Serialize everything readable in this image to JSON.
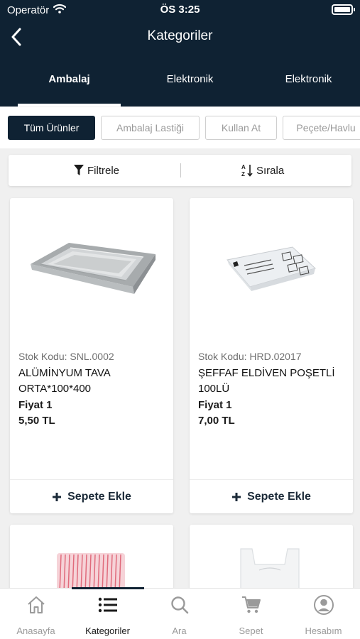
{
  "status_bar": {
    "carrier": "Operatör",
    "time": "ÖS 3:25"
  },
  "nav": {
    "title": "Kategoriler",
    "back_icon": "chevron-left-icon"
  },
  "category_tabs": [
    {
      "label": "Ambalaj",
      "active": true
    },
    {
      "label": "Elektronik",
      "active": false
    },
    {
      "label": "Elektronik",
      "active": false
    }
  ],
  "chips": [
    {
      "label": "Tüm Ürünler",
      "active": true
    },
    {
      "label": "Ambalaj Lastiği",
      "active": false
    },
    {
      "label": "Kullan At",
      "active": false
    },
    {
      "label": "Peçete/Havlu",
      "active": false
    }
  ],
  "filter_bar": {
    "filter_label": "Filtrele",
    "sort_label": "Sırala"
  },
  "products": [
    {
      "code": "Stok Kodu: SNL.0002",
      "name": "ALÜMİNYUM TAVA ORTA*100*400",
      "price_label": "Fiyat 1",
      "price": "5,50 TL",
      "add_label": "Sepete Ekle",
      "image": "aluminum-tray"
    },
    {
      "code": "Stok Kodu: HRD.02017",
      "name": "ŞEFFAF ELDİVEN POŞETLİ 100LÜ",
      "price_label": "Fiyat 1",
      "price": "7,00 TL",
      "add_label": "Sepete Ekle",
      "image": "glove-pack"
    },
    {
      "image": "straw-pack"
    },
    {
      "image": "plastic-bag"
    }
  ],
  "tab_bar": [
    {
      "label": "Anasayfa",
      "icon": "home-icon",
      "active": false
    },
    {
      "label": "Kategoriler",
      "icon": "list-icon",
      "active": true
    },
    {
      "label": "Ara",
      "icon": "search-icon",
      "active": false
    },
    {
      "label": "Sepet",
      "icon": "cart-icon",
      "active": false
    },
    {
      "label": "Hesabım",
      "icon": "account-icon",
      "active": false
    }
  ],
  "colors": {
    "header_bg": "#0f2233",
    "accent": "#0f2233",
    "page_bg": "#f0f0f0"
  }
}
